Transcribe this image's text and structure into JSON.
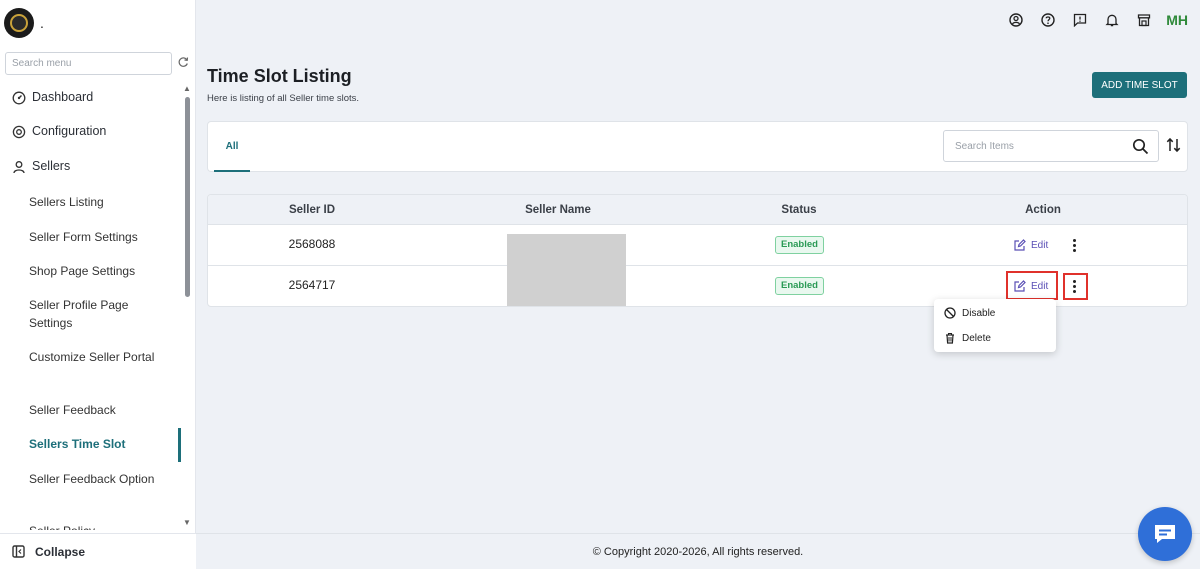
{
  "brand": {
    "label": "."
  },
  "sidebar": {
    "search_placeholder": "Search menu",
    "items": [
      {
        "label": "Dashboard",
        "icon": "gauge-icon"
      },
      {
        "label": "Configuration",
        "icon": "gear-icon"
      },
      {
        "label": "Sellers",
        "icon": "user-icon"
      },
      {
        "label": "Sellers Listing"
      },
      {
        "label": "Seller Form Settings"
      },
      {
        "label": "Shop Page Settings"
      },
      {
        "label": "Seller Profile Page Settings"
      },
      {
        "label": "Customize Seller Portal"
      },
      {
        "label": "Seller Feedback"
      },
      {
        "label": "Sellers Time Slot",
        "active": true
      },
      {
        "label": "Seller Feedback Option"
      },
      {
        "label": "Seller Policy"
      }
    ],
    "collapse_label": "Collapse"
  },
  "topbar": {
    "icons": [
      "account-circle-icon",
      "help-icon",
      "feedback-icon",
      "bell-icon",
      "store-icon"
    ],
    "avatar_initials": "MH"
  },
  "page": {
    "title": "Time Slot Listing",
    "subtitle": "Here is listing of all Seller time slots.",
    "add_button_label": "ADD TIME SLOT"
  },
  "filters": {
    "tabs": [
      {
        "label": "All",
        "active": true
      }
    ],
    "search_placeholder": "Search Items"
  },
  "table": {
    "columns": [
      "Seller ID",
      "Seller Name",
      "Status",
      "Action"
    ],
    "rows": [
      {
        "seller_id": "2568088",
        "seller_name": "",
        "status": "Enabled",
        "action_edit": "Edit"
      },
      {
        "seller_id": "2564717",
        "seller_name": "",
        "status": "Enabled",
        "action_edit": "Edit"
      }
    ]
  },
  "action_menu": {
    "items": [
      {
        "label": "Disable",
        "icon": "ban-icon"
      },
      {
        "label": "Delete",
        "icon": "trash-icon"
      }
    ]
  },
  "footer": {
    "copyright": "© Copyright 2020-2026, All rights reserved."
  },
  "colors": {
    "accent": "#1d6f7a",
    "status_enabled": "#2a9a55",
    "edit_link": "#5a4fb5",
    "highlight": "#e0312b",
    "chat_fab": "#2f6fd8",
    "avatar": "#2f8a3a"
  }
}
